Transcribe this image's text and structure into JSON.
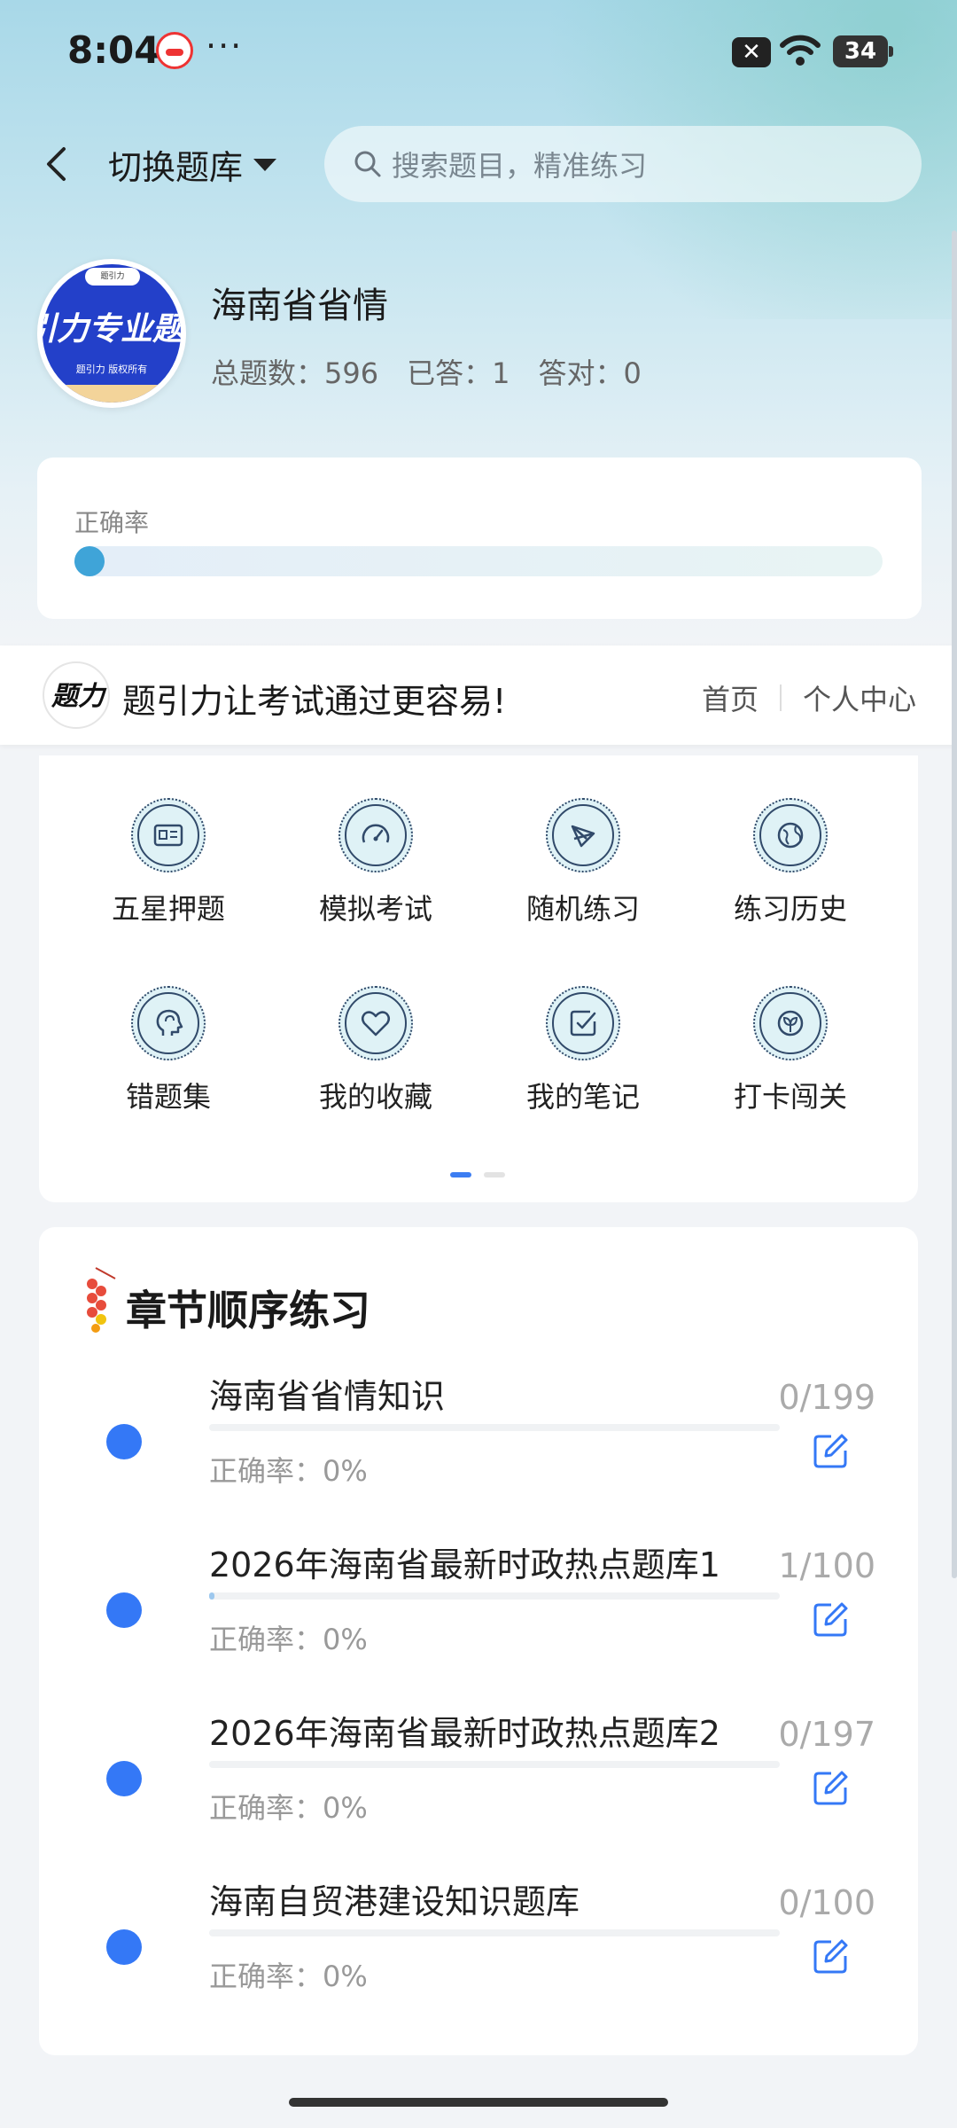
{
  "status": {
    "time": "8:04",
    "battery": "34"
  },
  "header": {
    "switch_label": "切换题库",
    "search_placeholder": "搜索题目，精准练习"
  },
  "bank": {
    "title": "海南省省情",
    "logo_text": "引力专业题",
    "logo_sub": "题引力 版权所有",
    "stats": {
      "total": "总题数：596",
      "answered": "已答：1",
      "correct": "答对：0"
    }
  },
  "accuracy": {
    "label": "正确率",
    "value": 0
  },
  "banner": {
    "text": "题引力让考试通过更容易!",
    "home": "首页",
    "profile": "个人中心"
  },
  "grid": [
    {
      "label": "五星押题",
      "icon": "id-card-icon"
    },
    {
      "label": "模拟考试",
      "icon": "gauge-icon"
    },
    {
      "label": "随机练习",
      "icon": "shuffle-icon"
    },
    {
      "label": "练习历史",
      "icon": "globe-icon"
    },
    {
      "label": "错题集",
      "icon": "head-icon"
    },
    {
      "label": "我的收藏",
      "icon": "heart-icon"
    },
    {
      "label": "我的笔记",
      "icon": "note-check-icon"
    },
    {
      "label": "打卡闯关",
      "icon": "leaf-icon"
    }
  ],
  "chapters": {
    "title": "章节顺序练习",
    "items": [
      {
        "name": "海南省省情知识",
        "count": "0/199",
        "accuracy": "正确率：0%",
        "progress": 0
      },
      {
        "name": "2026年海南省最新时政热点题库1",
        "count": "1/100",
        "accuracy": "正确率：0%",
        "progress": 0.01
      },
      {
        "name": "2026年海南省最新时政热点题库2",
        "count": "0/197",
        "accuracy": "正确率：0%",
        "progress": 0
      },
      {
        "name": "海南自贸港建设知识题库",
        "count": "0/100",
        "accuracy": "正确率：0%",
        "progress": 0
      }
    ]
  },
  "colors": {
    "accent": "#3478f6",
    "icon_fill": "#dff2f6"
  }
}
